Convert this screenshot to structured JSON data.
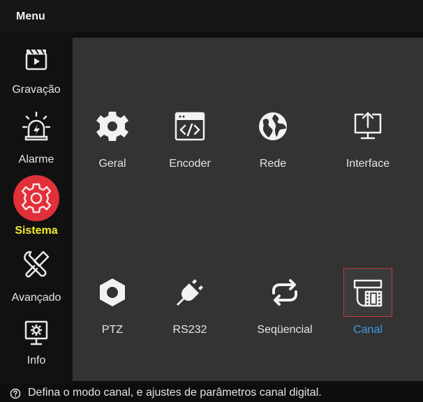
{
  "header": {
    "title": "Menu"
  },
  "sidebar": {
    "items": [
      {
        "label": "Gravação",
        "icon": "clapperboard-icon"
      },
      {
        "label": "Alarme",
        "icon": "alarm-siren-icon"
      },
      {
        "label": "Sistema",
        "icon": "gear-icon",
        "active": true
      },
      {
        "label": "Avançado",
        "icon": "tools-icon"
      },
      {
        "label": "Info",
        "icon": "monitor-settings-icon"
      }
    ]
  },
  "main": {
    "tiles": [
      {
        "label": "Geral",
        "icon": "gear-icon"
      },
      {
        "label": "Encoder",
        "icon": "code-window-icon"
      },
      {
        "label": "Rede",
        "icon": "globe-icon"
      },
      {
        "label": "Interface",
        "icon": "screen-upload-icon"
      },
      {
        "label": "PTZ",
        "icon": "hexagon-nut-icon"
      },
      {
        "label": "RS232",
        "icon": "plug-icon"
      },
      {
        "label": "Seqüencial",
        "icon": "loop-arrows-icon"
      },
      {
        "label": "Canal",
        "icon": "camera-film-icon",
        "selected": true
      }
    ]
  },
  "status": {
    "help_text": "Defina o modo canal, e ajustes de parâmetros canal digital."
  },
  "colors": {
    "active_sidebar_label": "#f6ee2c",
    "active_sidebar_circle": "#e0303a",
    "selected_tile_label": "#3e9be4",
    "selected_tile_border": "#c43a3a",
    "content_bg": "#333333"
  }
}
